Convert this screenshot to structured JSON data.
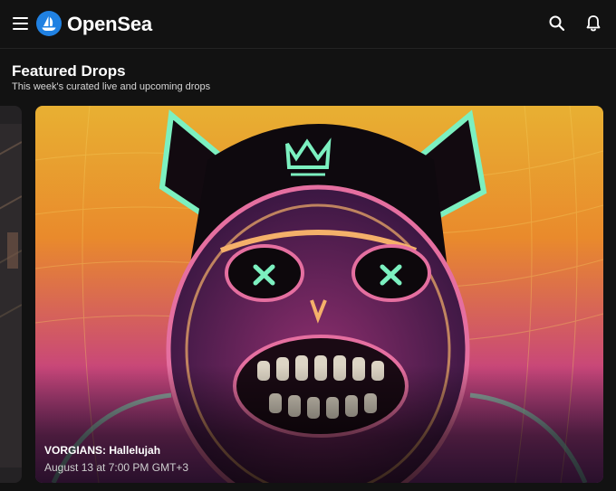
{
  "app": {
    "brand": "OpenSea"
  },
  "header": {
    "menu_icon": "hamburger-menu-icon",
    "logo_icon": "opensea-sailboat-logo-icon",
    "search_icon": "search-icon",
    "notifications_icon": "bell-icon"
  },
  "featured": {
    "title": "Featured Drops",
    "subtitle": "This week's curated live and upcoming drops"
  },
  "drop": {
    "name": "VORGIANS: Hallelujah",
    "date": "August 13 at 7:00 PM GMT+3"
  },
  "colors": {
    "background": "#121212",
    "brand_blue": "#2081E2",
    "art_orange": "#F0A030",
    "art_magenta": "#C0307A",
    "art_glow_green": "#7CF0C0"
  }
}
